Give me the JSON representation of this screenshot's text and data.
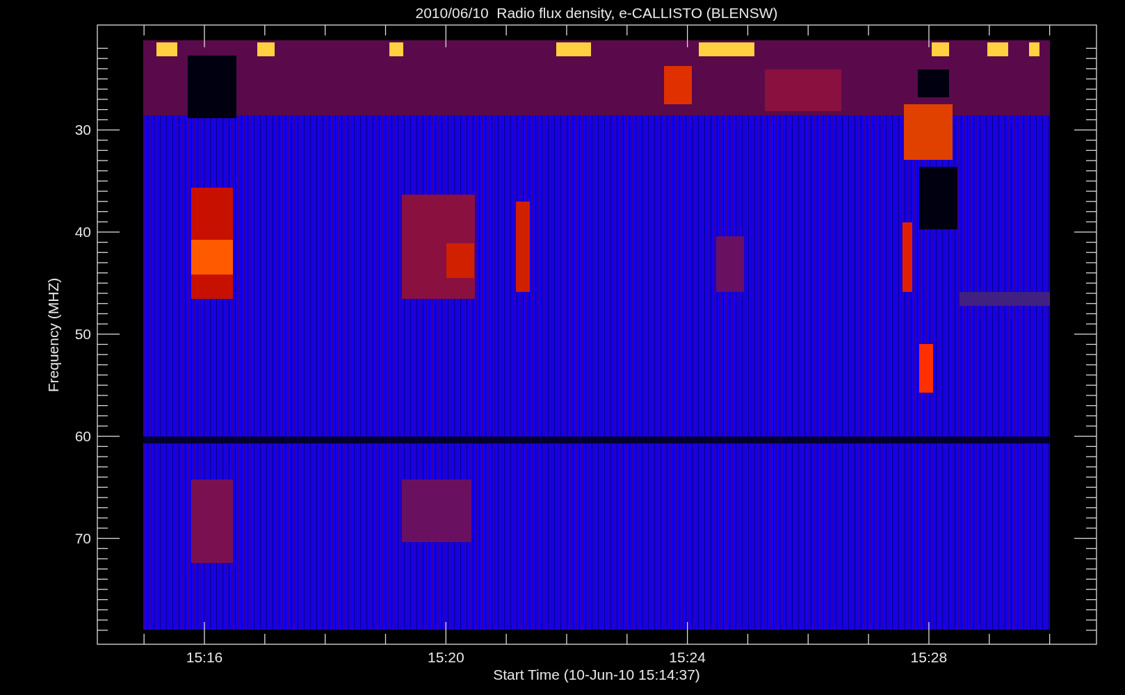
{
  "title": "2010/06/10  Radio flux density, e-CALLISTO (BLENSW)",
  "ylabel": "Frequency (MHZ)",
  "xlabel": "Start Time (10-Jun-10 15:14:37)",
  "yticks": [
    "30",
    "40",
    "50",
    "60",
    "70"
  ],
  "xticks": [
    "15:16",
    "15:20",
    "15:24",
    "15:28"
  ]
}
